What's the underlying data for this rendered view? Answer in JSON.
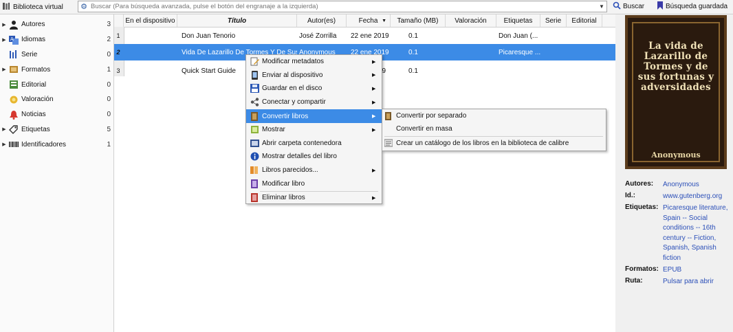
{
  "toolbar": {
    "library_label": "Biblioteca virtual",
    "search_placeholder": "Buscar (Para búsqueda avanzada, pulse el botón del engranaje a la izquierda)",
    "search_button": "Buscar",
    "saved_search_button": "Búsqueda guardada"
  },
  "sidebar": {
    "items": [
      {
        "label": "Autores",
        "count": "3",
        "icon": "person-icon"
      },
      {
        "label": "Idiomas",
        "count": "2",
        "icon": "language-icon"
      },
      {
        "label": "Serie",
        "count": "0",
        "icon": "series-icon"
      },
      {
        "label": "Formatos",
        "count": "1",
        "icon": "format-icon"
      },
      {
        "label": "Editorial",
        "count": "0",
        "icon": "publisher-icon"
      },
      {
        "label": "Valoración",
        "count": "0",
        "icon": "rating-icon"
      },
      {
        "label": "Noticias",
        "count": "0",
        "icon": "news-icon"
      },
      {
        "label": "Etiquetas",
        "count": "5",
        "icon": "tag-icon"
      },
      {
        "label": "Identificadores",
        "count": "1",
        "icon": "barcode-icon"
      }
    ]
  },
  "table": {
    "columns": [
      "En el dispositivo",
      "Título",
      "Autor(es)",
      "Fecha",
      "Tamaño (MB)",
      "Valoración",
      "Etiquetas",
      "Serie",
      "Editorial"
    ],
    "rows": [
      {
        "num": "1",
        "device": "",
        "title": "Don Juan Tenorio",
        "author": "José Zorrilla",
        "date": "22 ene 2019",
        "size": "0.1",
        "rating": "",
        "tags": "Don Juan (...",
        "series": "",
        "publisher": ""
      },
      {
        "num": "2",
        "device": "",
        "title": "Vida De Lazarillo De Tormes Y De Sus...",
        "author": "Anonymous",
        "date": "22 ene 2019",
        "size": "0.1",
        "rating": "",
        "tags": "Picaresque ...",
        "series": "",
        "publisher": ""
      },
      {
        "num": "3",
        "device": "",
        "title": "Quick Start Guide",
        "author": "",
        "date": "19",
        "size": "0.1",
        "rating": "",
        "tags": "",
        "series": "",
        "publisher": ""
      }
    ]
  },
  "context_menu": {
    "items": [
      {
        "label": "Modificar metadatos",
        "icon": "edit-metadata-icon",
        "submenu": true
      },
      {
        "label": "Enviar al dispositivo",
        "icon": "send-device-icon",
        "submenu": true
      },
      {
        "label": "Guardar en el disco",
        "icon": "save-disk-icon",
        "submenu": true
      },
      {
        "label": "Conectar y compartir",
        "icon": "connect-share-icon",
        "submenu": true
      },
      {
        "label": "Convertir libros",
        "icon": "convert-books-icon",
        "submenu": true
      },
      {
        "label": "Mostrar",
        "icon": "view-icon",
        "submenu": true
      },
      {
        "label": "Abrir carpeta contenedora",
        "icon": "folder-icon",
        "submenu": false
      },
      {
        "label": "Mostrar detalles del libro",
        "icon": "info-icon",
        "submenu": false
      },
      {
        "label": "Libros parecidos...",
        "icon": "similar-books-icon",
        "submenu": true
      },
      {
        "label": "Modificar libro",
        "icon": "edit-book-icon",
        "submenu": false
      },
      {
        "label": "Eliminar libros",
        "icon": "delete-books-icon",
        "submenu": true
      }
    ]
  },
  "submenu": {
    "items": [
      {
        "label": "Convertir por separado",
        "icon": "convert-individual-icon"
      },
      {
        "label": "Convertir en masa",
        "icon": ""
      },
      {
        "label": "Crear un catálogo de los libros en la biblioteca de calibre",
        "icon": "catalog-icon"
      }
    ]
  },
  "cover": {
    "title": "La vida de Lazarillo de Tormes y de sus fortunas y adversidades",
    "author": "Anonymous"
  },
  "details": {
    "authors_label": "Autores:",
    "authors_value": "Anonymous",
    "id_label": "Id.:",
    "id_value": "www.gutenberg.org",
    "tags_label": "Etiquetas:",
    "tags_value": "Picaresque literature, Spain -- Social conditions -- 16th century -- Fiction, Spanish, Spanish fiction",
    "formats_label": "Formatos:",
    "formats_value": "EPUB",
    "path_label": "Ruta:",
    "path_value": "Pulsar para abrir"
  },
  "colors": {
    "selection": "#3c8be6",
    "link": "#2b4fb8"
  }
}
